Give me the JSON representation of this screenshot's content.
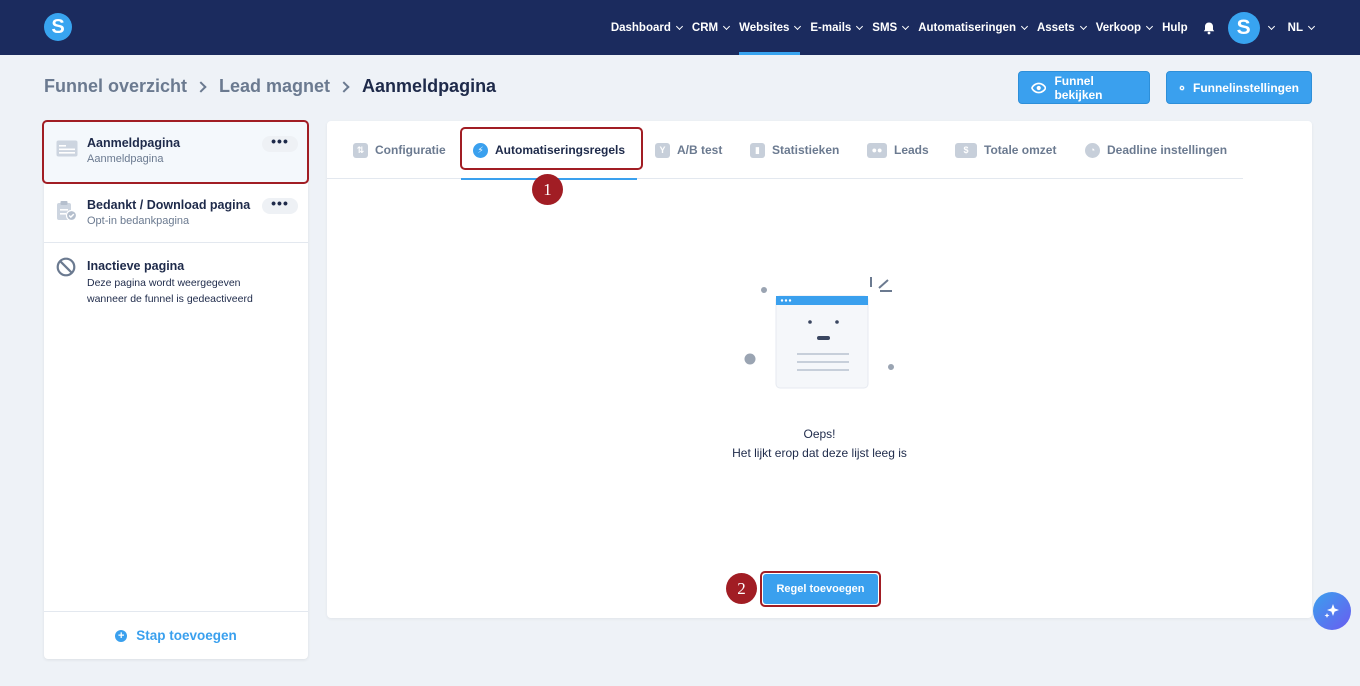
{
  "nav": {
    "items": [
      {
        "label": "Dashboard",
        "chevron": true
      },
      {
        "label": "CRM",
        "chevron": true
      },
      {
        "label": "Websites",
        "chevron": true,
        "active": true
      },
      {
        "label": "E-mails",
        "chevron": true
      },
      {
        "label": "SMS",
        "chevron": true
      },
      {
        "label": "Automatiseringen",
        "chevron": true
      },
      {
        "label": "Assets",
        "chevron": true
      },
      {
        "label": "Verkoop",
        "chevron": true
      },
      {
        "label": "Hulp",
        "chevron": false
      }
    ],
    "logo_letter": "S",
    "avatar_letter": "S",
    "language": "NL"
  },
  "breadcrumb": {
    "items": [
      "Funnel overzicht",
      "Lead magnet"
    ],
    "current": "Aanmeldpagina"
  },
  "header_buttons": {
    "view": "Funnel bekijken",
    "settings": "Funnelinstellingen"
  },
  "sidebar": {
    "steps": [
      {
        "title": "Aanmeldpagina",
        "subtitle": "Aanmeldpagina",
        "menu": "•••"
      },
      {
        "title": "Bedankt / Download pagina",
        "subtitle": "Opt-in bedankpagina",
        "menu": "•••"
      }
    ],
    "inactive": {
      "title": "Inactieve pagina",
      "description_line1": "Deze pagina wordt weergegeven",
      "description_line2": "wanneer de funnel is gedeactiveerd"
    },
    "add_step": "Stap toevoegen"
  },
  "tabs": [
    {
      "label": "Configuratie",
      "icon": "sliders-icon"
    },
    {
      "label": "Automatiseringsregels",
      "icon": "bolt-icon",
      "active": true
    },
    {
      "label": "A/B test",
      "icon": "split-icon"
    },
    {
      "label": "Statistieken",
      "icon": "bar-chart-icon"
    },
    {
      "label": "Leads",
      "icon": "users-icon"
    },
    {
      "label": "Totale omzet",
      "icon": "dollar-icon"
    },
    {
      "label": "Deadline instellingen",
      "icon": "clock-icon"
    }
  ],
  "empty_state": {
    "line1": "Oeps!",
    "line2": "Het lijkt erop dat deze lijst leeg is"
  },
  "add_rule_button": "Regel toevoegen",
  "markers": [
    "1",
    "2"
  ],
  "colors": {
    "navbar": "#1b2b5e",
    "accent": "#3aa0ee",
    "highlight": "#a11d24",
    "background": "#eef2f7"
  }
}
